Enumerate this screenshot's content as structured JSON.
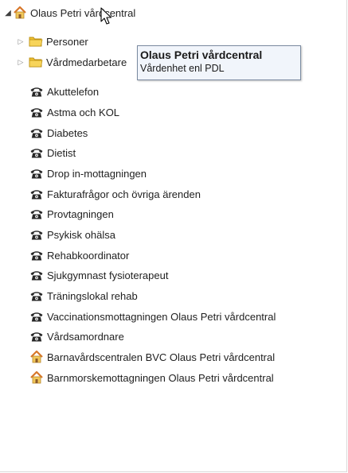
{
  "root": {
    "label": "Olaus Petri vårdcentral",
    "icon": "house-icon",
    "expanded": true
  },
  "children": [
    {
      "label": "Personer",
      "icon": "folder-icon",
      "type": "folder",
      "expandable": true
    },
    {
      "label": "Vårdmedarbetare",
      "icon": "folder-icon",
      "type": "folder",
      "expandable": true
    },
    {
      "label": "Akuttelefon",
      "icon": "phone-icon",
      "type": "function"
    },
    {
      "label": "Astma och KOL",
      "icon": "phone-icon",
      "type": "function"
    },
    {
      "label": "Diabetes",
      "icon": "phone-icon",
      "type": "function"
    },
    {
      "label": "Dietist",
      "icon": "phone-icon",
      "type": "function"
    },
    {
      "label": "Drop in-mottagningen",
      "icon": "phone-icon",
      "type": "function"
    },
    {
      "label": "Fakturafrågor och övriga ärenden",
      "icon": "phone-icon",
      "type": "function"
    },
    {
      "label": "Provtagningen",
      "icon": "phone-icon",
      "type": "function"
    },
    {
      "label": "Psykisk ohälsa",
      "icon": "phone-icon",
      "type": "function"
    },
    {
      "label": "Rehabkoordinator",
      "icon": "phone-icon",
      "type": "function"
    },
    {
      "label": "Sjukgymnast fysioterapeut",
      "icon": "phone-icon",
      "type": "function"
    },
    {
      "label": "Träningslokal rehab",
      "icon": "phone-icon",
      "type": "function"
    },
    {
      "label": "Vaccinationsmottagningen Olaus Petri vårdcentral",
      "icon": "phone-icon",
      "type": "function"
    },
    {
      "label": "Vårdsamordnare",
      "icon": "phone-icon",
      "type": "function"
    },
    {
      "label": "Barnavårdscentralen BVC Olaus Petri vårdcentral",
      "icon": "house-icon",
      "type": "unit"
    },
    {
      "label": "Barnmorskemottagningen Olaus Petri vårdcentral",
      "icon": "house-icon",
      "type": "unit"
    }
  ],
  "tooltip": {
    "title": "Olaus Petri vårdcentral",
    "subtitle": "Vårdenhet enl PDL"
  },
  "colors": {
    "folder": "#f2c230",
    "phone": "#262626",
    "house_roof": "#d8772a",
    "house_body": "#f1c75a",
    "tooltip_bg": "#f1f5fb"
  }
}
